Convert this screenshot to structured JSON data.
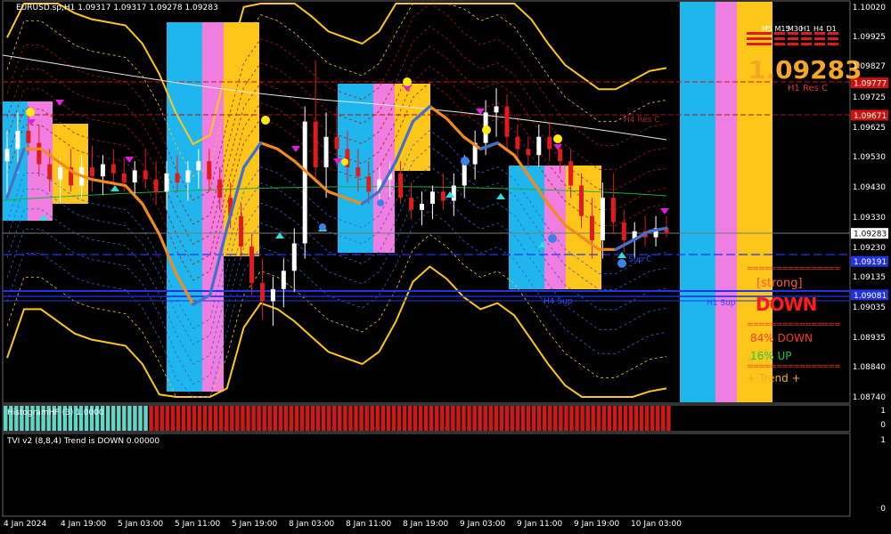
{
  "chart_data": {
    "type": "candlestick",
    "symbol_line": "EURUSD.sp,H1  1.09317 1.09317 1.09278 1.09283",
    "x_ticks": [
      "4 Jan 2024",
      "4 Jan 19:00",
      "5 Jan 03:00",
      "5 Jan 11:00",
      "5 Jan 19:00",
      "8 Jan 03:00",
      "8 Jan 11:00",
      "8 Jan 19:00",
      "9 Jan 03:00",
      "9 Jan 11:00",
      "9 Jan 19:00",
      "10 Jan 03:00"
    ],
    "y_ticks": [
      "1.10020",
      "1.09925",
      "1.09827",
      "1.09725",
      "1.09625",
      "1.09530",
      "1.09430",
      "1.09330",
      "1.09230",
      "1.09135",
      "1.09035",
      "1.08935",
      "1.08840",
      "1.08740"
    ],
    "current_price": "1.09283",
    "level_tags": [
      {
        "label": "1.09777",
        "price": 1.09777,
        "color": "#cc1111"
      },
      {
        "label": "1.09671",
        "price": 1.09671,
        "color": "#cc1111"
      },
      {
        "label": "1.09283",
        "price": 1.09283,
        "color": "#ffffff"
      },
      {
        "label": "1.09191",
        "price": 1.09191,
        "color": "#2233dd"
      },
      {
        "label": "1.09081",
        "price": 1.09081,
        "color": "#2233dd"
      }
    ],
    "timeframes": [
      "M5",
      "M15",
      "M30",
      "H1",
      "H4",
      "D1"
    ],
    "line_labels": {
      "h1_res": "H1 Res C",
      "h4_res": "H4 Res C",
      "h1_sup": "H1 Sup",
      "sup_c": "Sup C",
      "h4_sup": "H4 Sup"
    },
    "candles": [
      [
        1.0952,
        1.0962,
        1.094,
        1.0956
      ],
      [
        1.0956,
        1.0968,
        1.0948,
        1.0962
      ],
      [
        1.0962,
        1.097,
        1.0954,
        1.0958
      ],
      [
        1.0958,
        1.0964,
        1.0947,
        1.0951
      ],
      [
        1.0951,
        1.0956,
        1.0942,
        1.0946
      ],
      [
        1.0946,
        1.0953,
        1.0938,
        1.095
      ],
      [
        1.095,
        1.0956,
        1.0942,
        1.0944
      ],
      [
        1.0944,
        1.0954,
        1.094,
        1.095
      ],
      [
        1.095,
        1.0957,
        1.0942,
        1.0947
      ],
      [
        1.0947,
        1.0954,
        1.0941,
        1.0951
      ],
      [
        1.0951,
        1.0956,
        1.0944,
        1.0948
      ],
      [
        1.0948,
        1.0953,
        1.0942,
        1.0945
      ],
      [
        1.0945,
        1.0952,
        1.094,
        1.0949
      ],
      [
        1.0949,
        1.0956,
        1.0943,
        1.0946
      ],
      [
        1.0946,
        1.0952,
        1.0938,
        1.0942
      ],
      [
        1.0942,
        1.0952,
        1.0936,
        1.0948
      ],
      [
        1.0948,
        1.0954,
        1.0942,
        1.0945
      ],
      [
        1.0945,
        1.0952,
        1.0939,
        1.0949
      ],
      [
        1.0949,
        1.0956,
        1.0943,
        1.0952
      ],
      [
        1.0952,
        1.0956,
        1.0942,
        1.0946
      ],
      [
        1.0946,
        1.095,
        1.0936,
        1.094
      ],
      [
        1.094,
        1.0945,
        1.093,
        1.0934
      ],
      [
        1.0934,
        1.0938,
        1.092,
        1.0924
      ],
      [
        1.0924,
        1.0928,
        1.0908,
        1.0912
      ],
      [
        1.0912,
        1.092,
        1.09,
        1.0906
      ],
      [
        1.0906,
        1.0914,
        1.0898,
        1.091
      ],
      [
        1.091,
        1.092,
        1.0904,
        1.0916
      ],
      [
        1.0916,
        1.093,
        1.0909,
        1.0925
      ],
      [
        1.0925,
        1.097,
        1.092,
        1.0965
      ],
      [
        1.0965,
        1.0985,
        1.0945,
        1.095
      ],
      [
        1.095,
        1.0968,
        1.094,
        1.096
      ],
      [
        1.096,
        1.097,
        1.095,
        1.0956
      ],
      [
        1.0956,
        1.0962,
        1.0945,
        1.095
      ],
      [
        1.095,
        1.0956,
        1.0942,
        1.0947
      ],
      [
        1.0947,
        1.0952,
        1.0938,
        1.0942
      ],
      [
        1.0942,
        1.095,
        1.0937,
        1.0946
      ],
      [
        1.0946,
        1.0952,
        1.094,
        1.0948
      ],
      [
        1.0948,
        1.0952,
        1.0938,
        1.094
      ],
      [
        1.094,
        1.0945,
        1.0933,
        1.0936
      ],
      [
        1.0936,
        1.0942,
        1.0931,
        1.0938
      ],
      [
        1.0938,
        1.0944,
        1.0933,
        1.0942
      ],
      [
        1.0942,
        1.0948,
        1.0936,
        1.0939
      ],
      [
        1.0939,
        1.0948,
        1.0934,
        1.0944
      ],
      [
        1.0944,
        1.0954,
        1.094,
        1.0951
      ],
      [
        1.0951,
        1.0962,
        1.0946,
        1.0958
      ],
      [
        1.0958,
        1.0972,
        1.0954,
        1.0968
      ],
      [
        1.0968,
        1.0976,
        1.096,
        1.097
      ],
      [
        1.097,
        1.0974,
        1.0956,
        1.096
      ],
      [
        1.096,
        1.0964,
        1.0952,
        1.0956
      ],
      [
        1.0956,
        1.096,
        1.095,
        1.0954
      ],
      [
        1.0954,
        1.0964,
        1.095,
        1.096
      ],
      [
        1.096,
        1.0965,
        1.0952,
        1.0956
      ],
      [
        1.0956,
        1.096,
        1.0948,
        1.0952
      ],
      [
        1.0952,
        1.0956,
        1.094,
        1.0944
      ],
      [
        1.0944,
        1.0948,
        1.093,
        1.0934
      ],
      [
        1.0934,
        1.094,
        1.092,
        1.0926
      ],
      [
        1.0926,
        1.0945,
        1.092,
        1.094
      ],
      [
        1.094,
        1.0948,
        1.0928,
        1.0932
      ],
      [
        1.0932,
        1.0936,
        1.0922,
        1.0926
      ],
      [
        1.0926,
        1.0932,
        1.092,
        1.0929
      ],
      [
        1.0929,
        1.0934,
        1.0924,
        1.0927
      ],
      [
        1.0927,
        1.0934,
        1.0924,
        1.093
      ],
      [
        1.093,
        1.0934,
        1.0927,
        1.09283
      ]
    ],
    "smooth_line": [
      1.094,
      1.0956,
      1.0956,
      1.0952,
      1.0948,
      1.0946,
      1.0945,
      1.0944,
      1.0938,
      1.0928,
      1.0915,
      1.0905,
      1.0908,
      1.093,
      1.095,
      1.0958,
      1.0956,
      1.0952,
      1.0947,
      1.0942,
      1.094,
      1.0938,
      1.0942,
      1.0952,
      1.0965,
      1.097,
      1.0966,
      1.096,
      1.0956,
      1.0958,
      1.0954,
      1.0946,
      1.0938,
      1.0931,
      1.0927,
      1.0923,
      1.0923,
      1.0926,
      1.0929,
      1.093
    ],
    "histogram_label": "HistogramHF (3) 1.0000",
    "histogram_scale": [
      "1",
      "0"
    ],
    "tvi_label": "TVI v2 (8,8,4) Trend is DOWN 0.00000",
    "tvi_scale": [
      "1",
      "0"
    ],
    "panel": {
      "big_price": "1.09283",
      "strong": "[strong]",
      "direction": "DOWN",
      "down_pct": "84%  DOWN",
      "up_pct": "16%      UP",
      "trend": "+    Trend    +",
      "separator": "================"
    },
    "colors": {
      "bear": "#e01b1b",
      "bull": "#ffffff",
      "cyan": "#1fb6ee",
      "pink": "#ef7ee0",
      "yellow": "#ffc61a",
      "orange": "#f28a1e",
      "blue": "#3f6fd0"
    }
  }
}
